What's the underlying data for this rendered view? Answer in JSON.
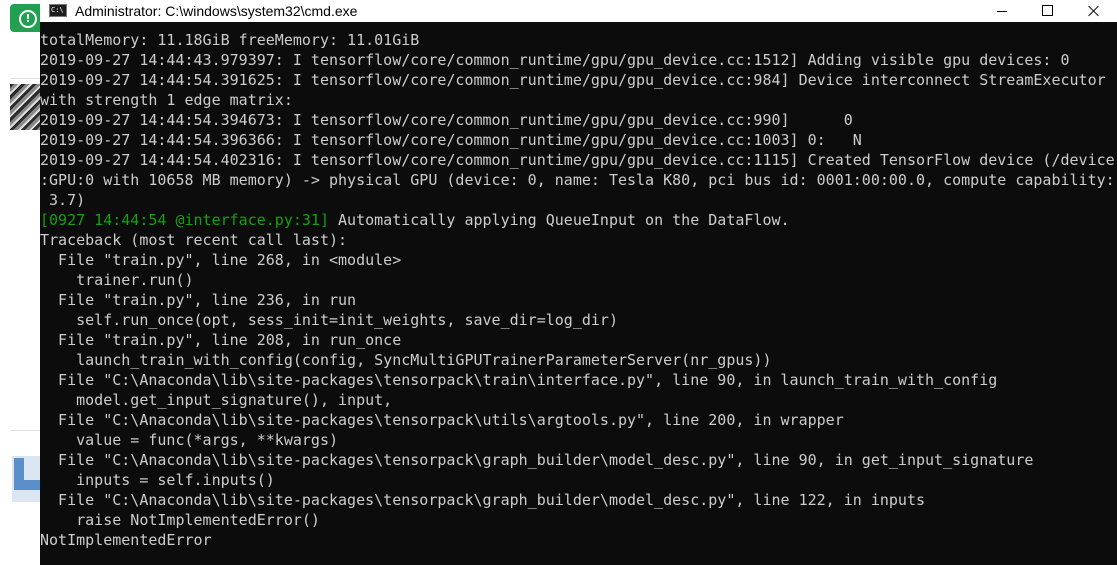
{
  "background_app": {
    "badge_icon": "info-circle-icon",
    "badge_color": "#22a052"
  },
  "window": {
    "title": "Administrator: C:\\windows\\system32\\cmd.exe",
    "icon_label": "C:\\",
    "controls": {
      "minimize": "minimize-icon",
      "maximize": "maximize-icon",
      "close": "close-icon"
    }
  },
  "colors": {
    "console_bg": "#0c0c0c",
    "console_fg": "#cccccc",
    "log_prefix": "#13a10e"
  },
  "console": {
    "lines": [
      "totalMemory: 11.18GiB freeMemory: 11.01GiB",
      "2019-09-27 14:44:43.979397: I tensorflow/core/common_runtime/gpu/gpu_device.cc:1512] Adding visible gpu devices: 0",
      "2019-09-27 14:44:54.391625: I tensorflow/core/common_runtime/gpu/gpu_device.cc:984] Device interconnect StreamExecutor",
      "with strength 1 edge matrix:",
      "2019-09-27 14:44:54.394673: I tensorflow/core/common_runtime/gpu/gpu_device.cc:990]      0",
      "2019-09-27 14:44:54.396366: I tensorflow/core/common_runtime/gpu/gpu_device.cc:1003] 0:   N",
      "2019-09-27 14:44:54.402316: I tensorflow/core/common_runtime/gpu/gpu_device.cc:1115] Created TensorFlow device (/device",
      ":GPU:0 with 10658 MB memory) -> physical GPU (device: 0, name: Tesla K80, pci bus id: 0001:00:00.0, compute capability:",
      " 3.7)",
      "",
      "Traceback (most recent call last):",
      "  File \"train.py\", line 268, in <module>",
      "    trainer.run()",
      "  File \"train.py\", line 236, in run",
      "    self.run_once(opt, sess_init=init_weights, save_dir=log_dir)",
      "  File \"train.py\", line 208, in run_once",
      "    launch_train_with_config(config, SyncMultiGPUTrainerParameterServer(nr_gpus))",
      "  File \"C:\\Anaconda\\lib\\site-packages\\tensorpack\\train\\interface.py\", line 90, in launch_train_with_config",
      "    model.get_input_signature(), input,",
      "  File \"C:\\Anaconda\\lib\\site-packages\\tensorpack\\utils\\argtools.py\", line 200, in wrapper",
      "    value = func(*args, **kwargs)",
      "  File \"C:\\Anaconda\\lib\\site-packages\\tensorpack\\graph_builder\\model_desc.py\", line 90, in get_input_signature",
      "    inputs = self.inputs()",
      "  File \"C:\\Anaconda\\lib\\site-packages\\tensorpack\\graph_builder\\model_desc.py\", line 122, in inputs",
      "    raise NotImplementedError()",
      "NotImplementedError"
    ],
    "log_line": {
      "prefix": "[0927 14:44:54 @interface.py:31]",
      "message": " Automatically applying QueueInput on the DataFlow."
    }
  }
}
